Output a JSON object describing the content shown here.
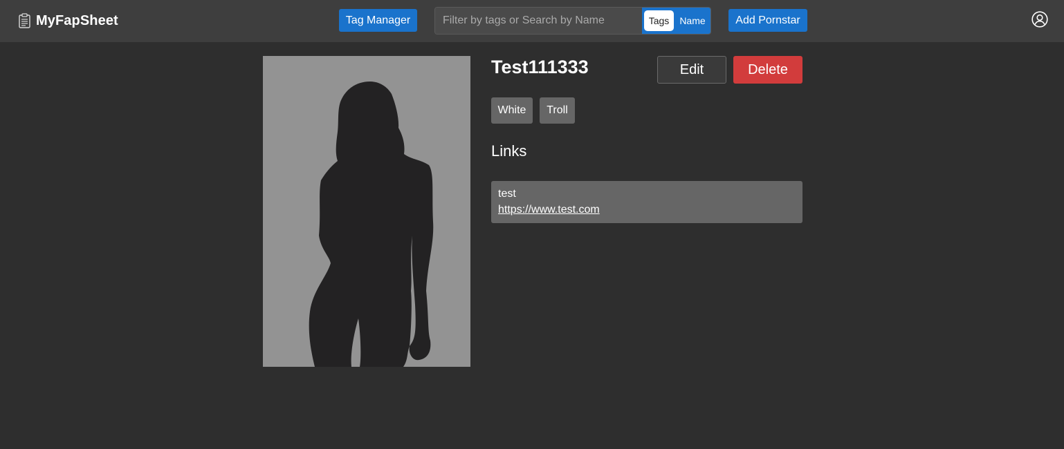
{
  "navbar": {
    "brand": "MyFapSheet",
    "brand_icon": "clipboard-icon",
    "tag_manager_label": "Tag Manager",
    "search": {
      "placeholder": "Filter by tags or Search by Name",
      "value": "",
      "toggle_tags": "Tags",
      "toggle_name": "Name",
      "active_toggle": "Tags"
    },
    "add_label": "Add Pornstar",
    "user_icon": "user-circle-icon"
  },
  "profile": {
    "name": "Test111333",
    "photo_icon": "silhouette-placeholder",
    "edit_label": "Edit",
    "delete_label": "Delete",
    "tags": [
      "White",
      "Troll"
    ],
    "links_heading": "Links",
    "links": [
      {
        "name": "test",
        "url": "https://www.test.com"
      }
    ]
  },
  "colors": {
    "background": "#2e2e2e",
    "navbar": "#3e3e3e",
    "primary": "#1a73cc",
    "danger": "#d23c3c",
    "tag": "#666666",
    "photo_background": "#939393"
  }
}
